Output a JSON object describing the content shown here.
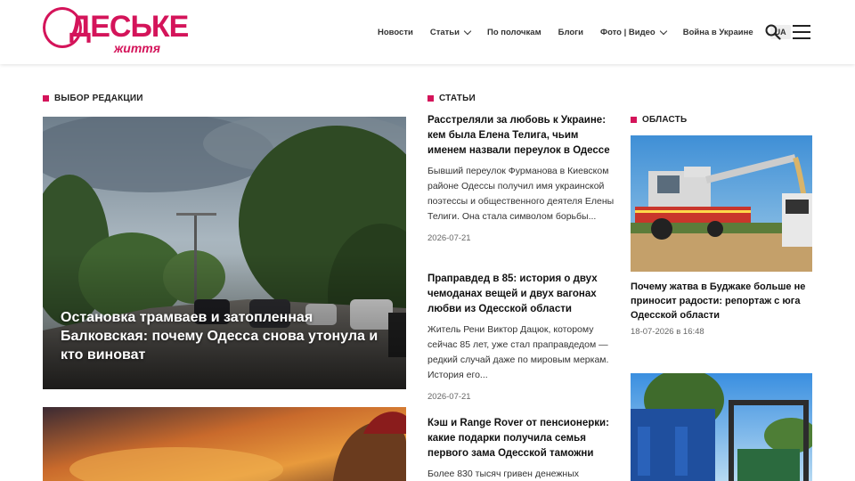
{
  "site": {
    "logo_main": "ДЕСЬКЕ",
    "logo_sub": "життя"
  },
  "nav": {
    "items": [
      {
        "label": "Новости",
        "has_dropdown": false
      },
      {
        "label": "Статьи",
        "has_dropdown": true
      },
      {
        "label": "По полочкам",
        "has_dropdown": false
      },
      {
        "label": "Блоги",
        "has_dropdown": false
      },
      {
        "label": "Фото | Видео",
        "has_dropdown": true
      },
      {
        "label": "Война в Украине",
        "has_dropdown": false
      }
    ],
    "lang": "UA",
    "icons": [
      "search-icon",
      "hamburger-menu-icon"
    ]
  },
  "colors": {
    "accent": "#d4145a"
  },
  "editors_choice": {
    "heading": "ВЫБОР РЕДАКЦИИ",
    "items": [
      {
        "title": "Остановка трамваев и затопленная Балковская: почему Одесса снова утонула и кто виноват"
      },
      {
        "title": ""
      }
    ]
  },
  "articles": {
    "heading": "СТАТЬИ",
    "items": [
      {
        "title": "Расстреляли за любовь к Украине: кем была Елена Телига, чьим именем назвали переулок в Одессе",
        "lead": "Бывший переулок Фурманова в Киевском районе Одессы получил имя украинской поэтессы и общественного деятеля Елены Телиги. Она стала символом борьбы...",
        "date": "2026-07-21"
      },
      {
        "title": "Праправдед в 85: история о двух чемоданах вещей и двух вагонах любви из Одесской области",
        "lead": "Житель Рени Виктор Дацюк, которому сейчас 85 лет, уже стал праправдедом — редкий случай даже по мировым меркам. История его...",
        "date": "2026-07-21"
      },
      {
        "title": "Кэш и Range Rover от пенсионерки: какие подарки получила семья первого зама Одесской таможни",
        "lead": "Более 830 тысяч гривен денежных",
        "date": ""
      }
    ]
  },
  "region": {
    "heading": "ОБЛАСТЬ",
    "items": [
      {
        "title": "Почему жатва в Буджаке больше не приносит радости: репортаж с юга Одесской области",
        "date": "18-07-2026 в 16:48"
      }
    ]
  }
}
